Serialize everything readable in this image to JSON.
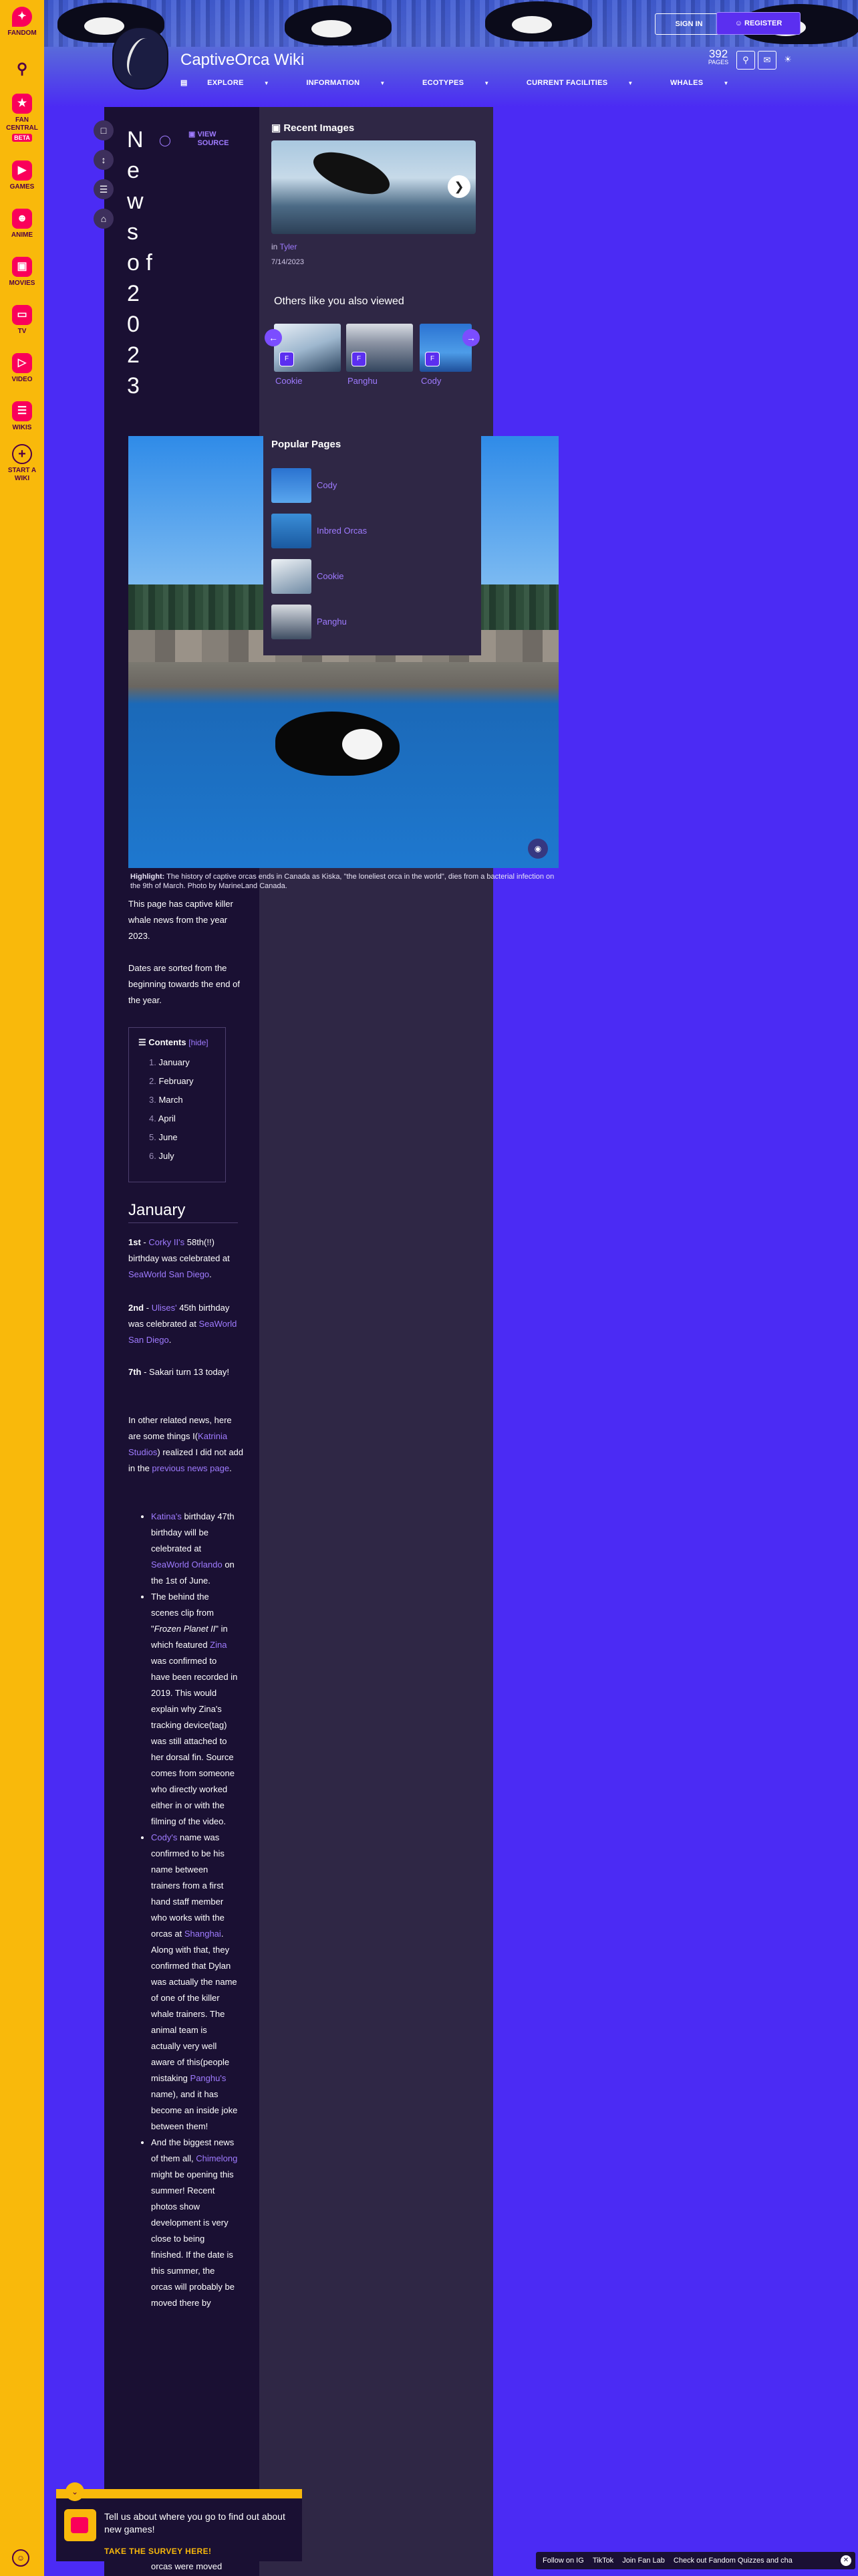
{
  "global_nav": {
    "fandom": "FANDOM",
    "fan_central": "FAN CENTRAL",
    "beta": "BETA",
    "games": "GAMES",
    "anime": "ANIME",
    "movies": "MOVIES",
    "tv": "TV",
    "video": "VIDEO",
    "wikis": "WIKIS",
    "start_a_wiki": "START A WIKI"
  },
  "header": {
    "wiki_title": "CaptiveOrca Wiki",
    "sign_in": "SIGN IN",
    "register": "REGISTER",
    "pages_count": "392",
    "pages_label": "PAGES",
    "nav": [
      "EXPLORE",
      "INFORMATION",
      "ECOTYPES",
      "CURRENT FACILITIES",
      "WHALES"
    ]
  },
  "article": {
    "title_chars": [
      "N",
      "e",
      "w",
      "s",
      "o",
      "f",
      "2",
      "0",
      "2",
      "3"
    ],
    "view_source": "VIEW SOURCE",
    "caption_bold": "Highlight:",
    "caption_text": " The history of captive orcas ends in Canada as Kiska, \"the loneliest orca in the world\", dies from a bacterial infection on the 9th of March. Photo by MarineLand Canada.",
    "intro_1": "This page has captive killer whale news from the year 2023.",
    "intro_2": "Dates are sorted from the beginning towards the end of the year.",
    "toc": {
      "title": "Contents",
      "hide": "hide",
      "items": [
        "January",
        "February",
        "March",
        "April",
        "June",
        "July"
      ],
      "numbers": [
        "1.",
        "2.",
        "3.",
        "4.",
        "5.",
        "6."
      ]
    },
    "january": {
      "heading": "January",
      "p1_date": "1st",
      "p1_dash": " - ",
      "p1_link": "Corky II's",
      "p1_rest": " 58th(!!) birthday was celebrated at ",
      "p1_place": "SeaWorld San Diego",
      "p1_end": ".",
      "p2_date": "2nd",
      "p2_dash": " - ",
      "p2_link": "Ulises'",
      "p2_rest": " 45th birthday was celebrated at ",
      "p2_place": "SeaWorld San Diego",
      "p2_end": ".",
      "p3_date": "7th",
      "p3_rest": " - Sakari turn 13 today!",
      "p4_a": "In other related news, here are some things I(",
      "p4_link1": "Katrinia Studios",
      "p4_b": ") realized I did not add in the ",
      "p4_link2": "previous news page",
      "p4_end": ".",
      "b1_link": "Katina's",
      "b1_a": " birthday 47th birthday will be celebrated at ",
      "b1_place": "SeaWorld Orlando",
      "b1_end": " on the 1st of June.",
      "b2_a": "The behind the scenes clip from \"",
      "b2_em": "Frozen Planet II",
      "b2_b": "\" in which featured ",
      "b2_link": "Zina",
      "b2_c": " was confirmed to have been recorded in 2019. This would explain why Zina's tracking device(tag) was still attached to her dorsal fin. Source comes from someone who directly worked either in or with the filming of the video.",
      "b3_link": "Cody's",
      "b3_a": " name was confirmed to be his name between trainers from a first hand staff member who works with the orcas at ",
      "b3_place": "Shanghai",
      "b3_b": ". Along with that, they confirmed that Dylan was actually the name of one of the killer whale trainers. The animal team is actually very well aware of this(people mistaking ",
      "b3_link2": "Panghu's",
      "b3_c": " name), and it has become an inside joke between them!",
      "b4_a": "And the biggest news of them all, ",
      "b4_link": "Chimelong",
      "b4_b": " might be opening this summer! Recent photos show development is very close to being finished. If the date is this summer, the orcas will probably be moved there by",
      "b4_c": "orcas were moved"
    }
  },
  "rail": {
    "recent_images_title": "Recent Images",
    "recent_in": "in ",
    "recent_link": "Tyler",
    "recent_date": "7/14/2023",
    "others_title": "Others like you also viewed",
    "others": [
      "Cookie",
      "Panghu",
      "Cody"
    ],
    "popular_title": "Popular Pages",
    "popular": [
      "Cody",
      "Inbred Orcas",
      "Cookie",
      "Panghu"
    ]
  },
  "survey": {
    "message": "Tell us about where you go to find out about new games!",
    "cta": "TAKE THE SURVEY HERE!"
  },
  "footer_links": [
    "Follow on IG",
    "TikTok",
    "Join Fan Lab",
    "Check out Fandom Quizzes and cha"
  ],
  "colors": {
    "background": "#4b2bf4",
    "global_nav": "#f9b90b",
    "article_bg": "#1a1033",
    "rail_bg": "#2f2745",
    "link": "#9f7bff"
  }
}
